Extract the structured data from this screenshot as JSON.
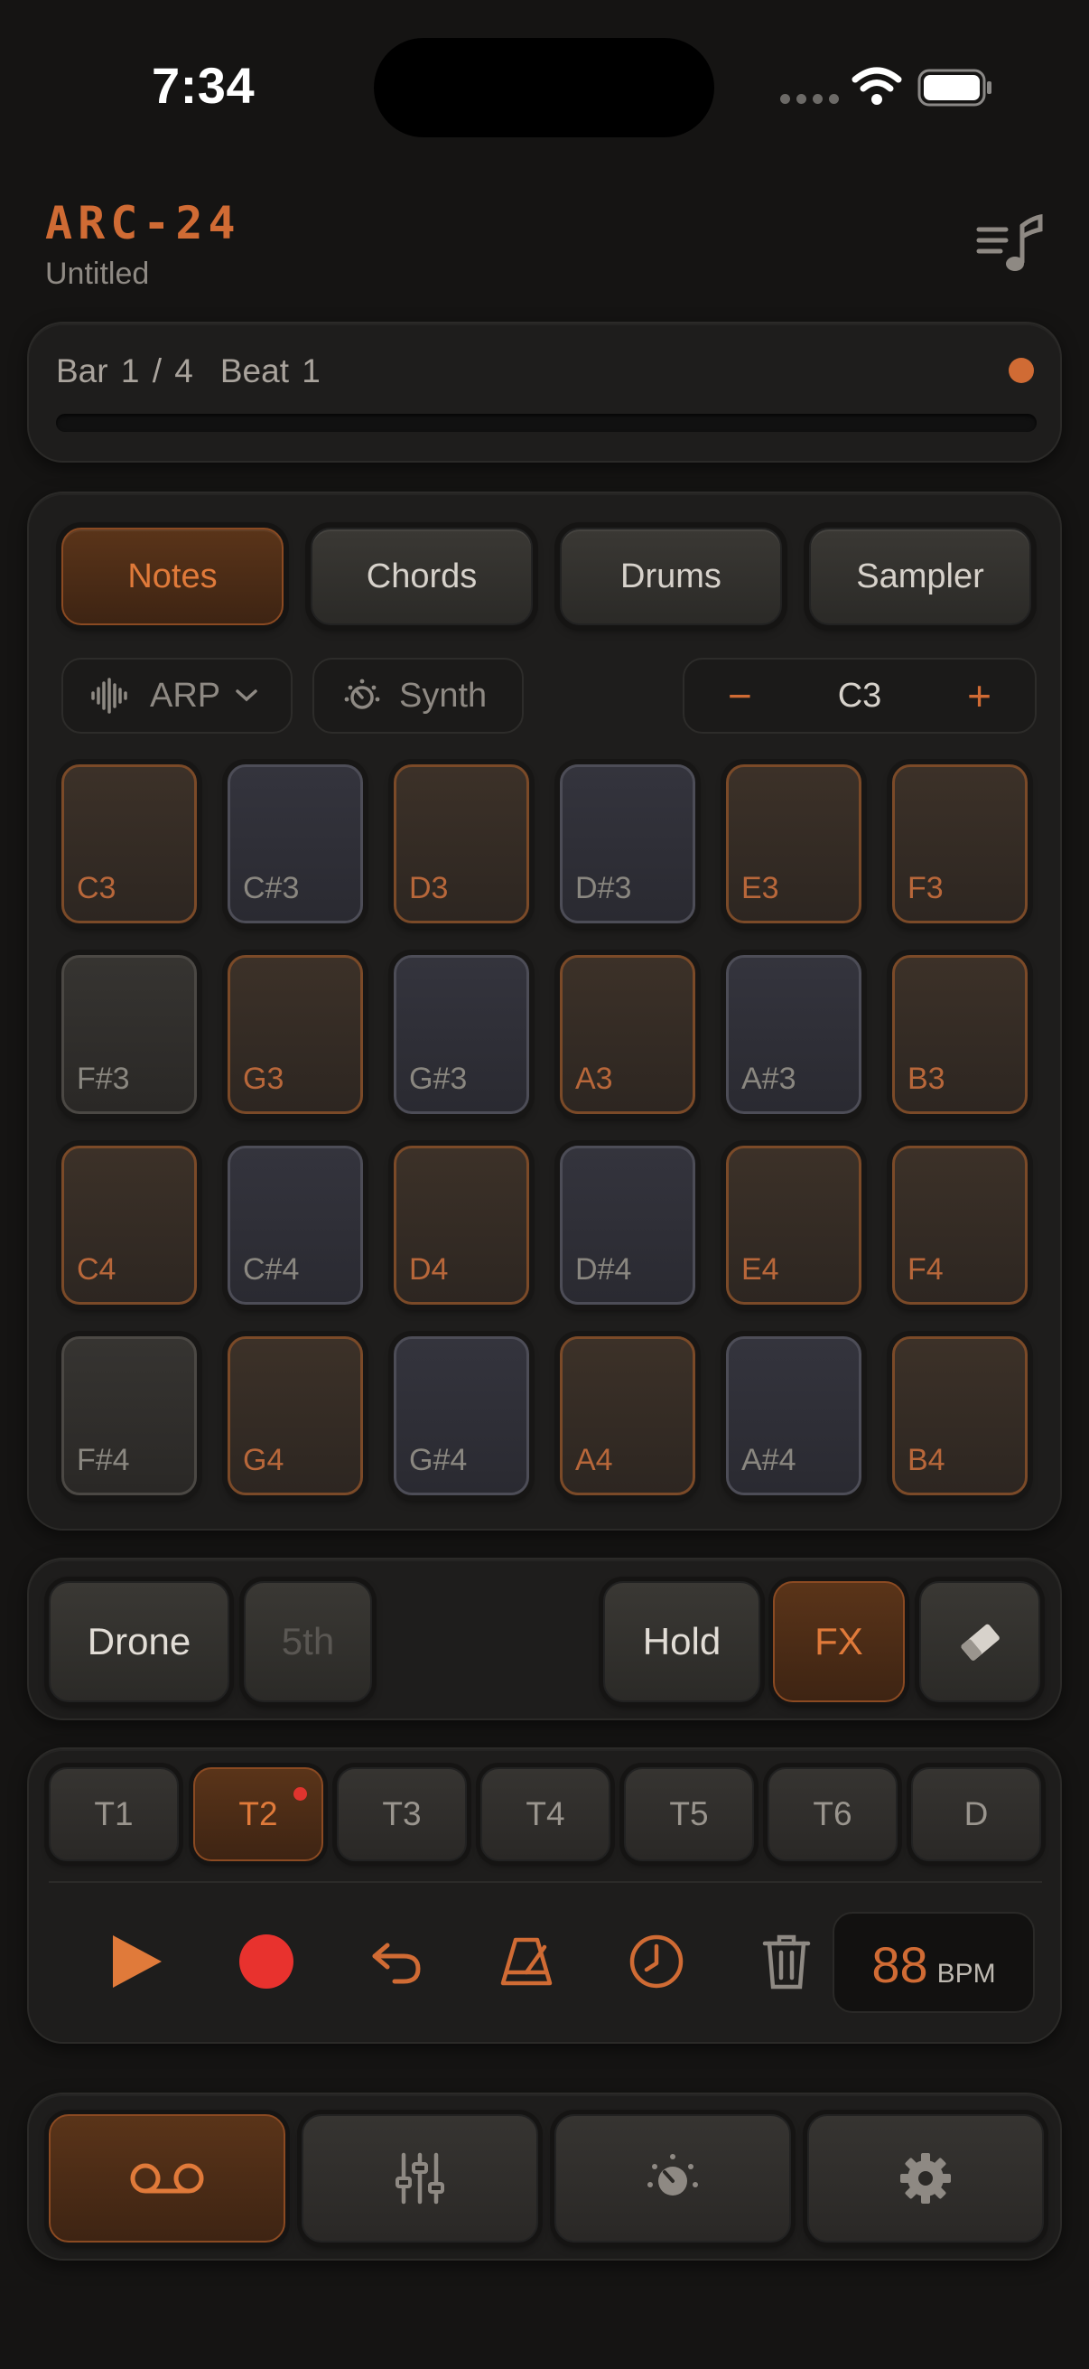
{
  "status_bar": {
    "time": "7:34"
  },
  "header": {
    "title": "ARC-24",
    "subtitle": "Untitled"
  },
  "position": {
    "bar": "Bar 1 / 4",
    "beat": "Beat 1",
    "progress": 0
  },
  "modes": [
    "Notes",
    "Chords",
    "Drums",
    "Sampler"
  ],
  "controls": {
    "arp_label": "ARP",
    "synth_label": "Synth",
    "octave_minus": "−",
    "octave_value": "C3",
    "octave_plus": "+"
  },
  "pads": [
    [
      "C3",
      "C#3",
      "D3",
      "D#3",
      "E3",
      "F3"
    ],
    [
      "F#3",
      "G3",
      "G#3",
      "A3",
      "A#3",
      "B3"
    ],
    [
      "C4",
      "C#4",
      "D4",
      "D#4",
      "E4",
      "F4"
    ],
    [
      "F#4",
      "G4",
      "G#4",
      "A4",
      "A#4",
      "B4"
    ]
  ],
  "drone_bar": {
    "drone": "Drone",
    "fifth": "5th",
    "hold": "Hold",
    "fx": "FX"
  },
  "tracks": [
    "T1",
    "T2",
    "T3",
    "T4",
    "T5",
    "T6",
    "D"
  ],
  "tempo": {
    "bpm": "88",
    "unit": "BPM"
  },
  "colors": {
    "accent": "#d06b34",
    "record": "#e0342e",
    "background": "#151413"
  },
  "icons": {
    "header": "track-list-icon",
    "transport": [
      "play-icon",
      "record-icon",
      "undo-icon",
      "metronome-icon",
      "clock-icon",
      "trash-icon"
    ],
    "nav": [
      "tape-icon",
      "mixer-icon",
      "synth-knob-icon",
      "settings-icon"
    ]
  }
}
